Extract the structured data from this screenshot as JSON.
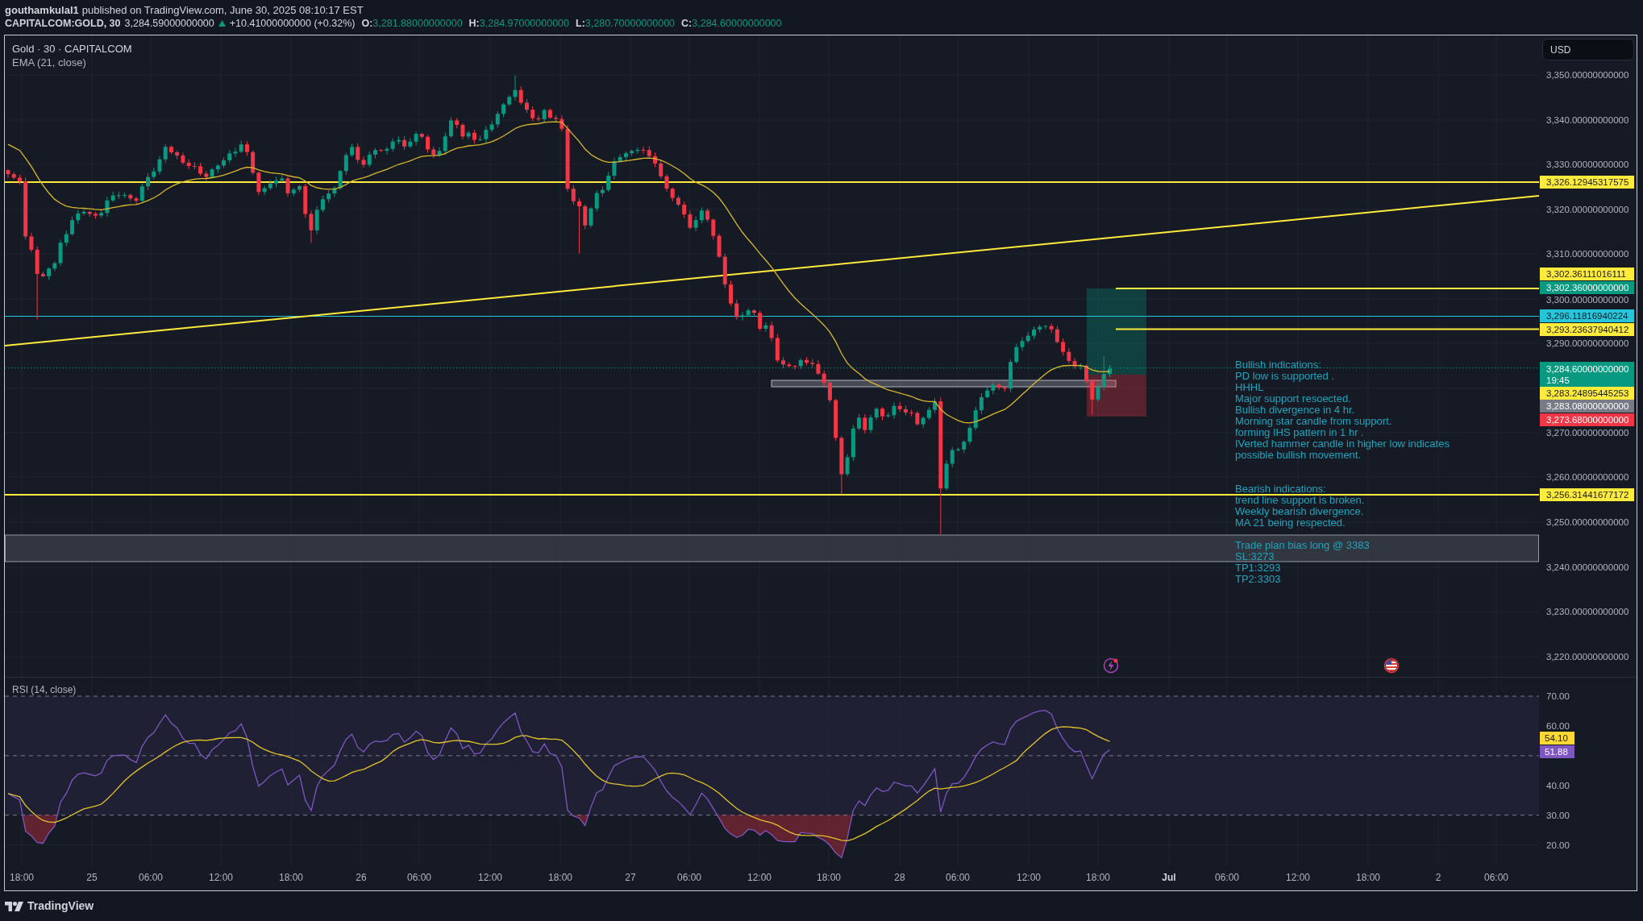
{
  "header": {
    "author": "gouthamkulal1",
    "published": "published on TradingView.com, June 30, 2025 08:10:17 EST",
    "symbol": "CAPITALCOM:GOLD, 30",
    "last": "3,284.59000000000",
    "rising": true,
    "change": "+10.41000000000 (+0.32%)",
    "ohlc": [
      {
        "label": "O:",
        "value": "3,281.88000000000"
      },
      {
        "label": "H:",
        "value": "3,284.97000000000"
      },
      {
        "label": "L:",
        "value": "3,280.70000000000"
      },
      {
        "label": "C:",
        "value": "3,284.60000000000"
      }
    ]
  },
  "price_pane": {
    "title": "Gold · 30 · CAPITALCOM",
    "indicator": "EMA (21, close)",
    "currency": "USD",
    "ticks": [
      "3,350.00000000000",
      "3,340.00000000000",
      "3,330.00000000000",
      "3,320.00000000000",
      "3,310.00000000000",
      "3,300.00000000000",
      "3,290.00000000000",
      "3,270.00000000000",
      "3,260.00000000000",
      "3,250.00000000000",
      "3,240.00000000000",
      "3,230.00000000000",
      "3,220.00000000000"
    ],
    "badges": [
      {
        "text": "3,326.12945317575",
        "color": "#ffeb3b"
      },
      {
        "text": "3,302.36111016111",
        "color": "#ffeb3b"
      },
      {
        "text": "3,302.36000000000",
        "color": "#089981"
      },
      {
        "text": "3,296.11816940224",
        "color": "#26c6da"
      },
      {
        "text": "3,293.23637940412",
        "color": "#ffeb3b"
      },
      {
        "text": "3,284.60000000000",
        "countdown": "19:45",
        "color": "#089981"
      },
      {
        "text": "3,283.24895445253",
        "color": "#ffeb3b"
      },
      {
        "text": "3,283.08000000000",
        "color": "#787b86"
      },
      {
        "text": "3,273.68000000000",
        "color": "#f23645"
      },
      {
        "text": "3,256.31441677172",
        "color": "#ffeb3b"
      }
    ],
    "notes": [
      {
        "lines": [
          "Bullish indications:",
          "PD low is supported .",
          "HHHL",
          "Major support resoected.",
          "Bullish divergence in 4 hr.",
          "Morning star candle from support.",
          "forming IHS pattern in 1 hr .",
          "IVerted hammer candle in higher low indicates",
          "possible bullish movement."
        ]
      },
      {
        "lines": [
          "Bearish indications:",
          "trend line support is broken.",
          "Weekly bearish divergence.",
          "MA 21 being respected."
        ]
      },
      {
        "lines": [
          "Trade plan bias long @ 3383",
          "SL:3273",
          "TP1:3293",
          "TP2:3303"
        ]
      }
    ]
  },
  "rsi_pane": {
    "title": "RSI (14, close)",
    "ticks": [
      "70.00",
      "60.00",
      "40.00",
      "30.00",
      "20.00"
    ],
    "badges": [
      {
        "text": "54.10",
        "color": "#fdd835"
      },
      {
        "text": "51.88",
        "color": "#7e57c2"
      }
    ]
  },
  "time_axis": {
    "labels": [
      {
        "text": "18:00",
        "bold": false
      },
      {
        "text": "25",
        "bold": false
      },
      {
        "text": "06:00",
        "bold": false
      },
      {
        "text": "12:00",
        "bold": false
      },
      {
        "text": "18:00",
        "bold": false
      },
      {
        "text": "26",
        "bold": false
      },
      {
        "text": "06:00",
        "bold": false
      },
      {
        "text": "12:00",
        "bold": false
      },
      {
        "text": "18:00",
        "bold": false
      },
      {
        "text": "27",
        "bold": false
      },
      {
        "text": "06:00",
        "bold": false
      },
      {
        "text": "12:00",
        "bold": false
      },
      {
        "text": "18:00",
        "bold": false
      },
      {
        "text": "28",
        "bold": false
      },
      {
        "text": "06:00",
        "bold": false
      },
      {
        "text": "12:00",
        "bold": false
      },
      {
        "text": "18:00",
        "bold": false
      },
      {
        "text": "Jul",
        "bold": true
      },
      {
        "text": "06:00",
        "bold": false
      },
      {
        "text": "12:00",
        "bold": false
      },
      {
        "text": "18:00",
        "bold": false
      },
      {
        "text": "2",
        "bold": false
      },
      {
        "text": "06:00",
        "bold": false
      }
    ]
  },
  "footer": {
    "brand": "TradingView"
  }
}
